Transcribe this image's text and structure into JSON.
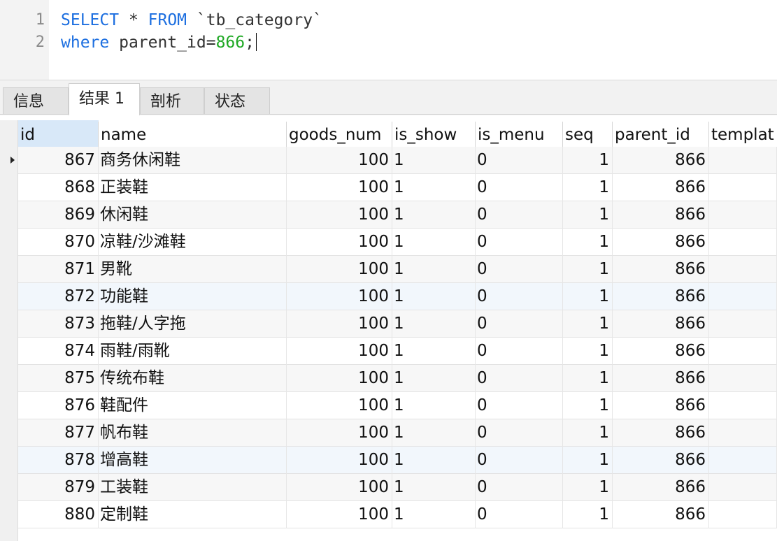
{
  "editor": {
    "line_numbers": [
      "1",
      "2"
    ],
    "line1": {
      "kw1": "SELECT",
      "t1": " * ",
      "kw2": "FROM",
      "t2": " `tb_category`"
    },
    "line2": {
      "kw1": "where",
      "t1": " parent_id=",
      "num": "866",
      "t2": ";"
    }
  },
  "tabs": [
    "信息",
    "结果 1",
    "剖析",
    "状态"
  ],
  "active_tab": 1,
  "columns": [
    "id",
    "name",
    "goods_num",
    "is_show",
    "is_menu",
    "seq",
    "parent_id",
    "templat"
  ],
  "rows": [
    [
      "867",
      "商务休闲鞋",
      "100",
      "1",
      "0",
      "1",
      "866",
      ""
    ],
    [
      "868",
      "正装鞋",
      "100",
      "1",
      "0",
      "1",
      "866",
      ""
    ],
    [
      "869",
      "休闲鞋",
      "100",
      "1",
      "0",
      "1",
      "866",
      ""
    ],
    [
      "870",
      "凉鞋/沙滩鞋",
      "100",
      "1",
      "0",
      "1",
      "866",
      ""
    ],
    [
      "871",
      "男靴",
      "100",
      "1",
      "0",
      "1",
      "866",
      ""
    ],
    [
      "872",
      "功能鞋",
      "100",
      "1",
      "0",
      "1",
      "866",
      ""
    ],
    [
      "873",
      "拖鞋/人字拖",
      "100",
      "1",
      "0",
      "1",
      "866",
      ""
    ],
    [
      "874",
      "雨鞋/雨靴",
      "100",
      "1",
      "0",
      "1",
      "866",
      ""
    ],
    [
      "875",
      "传统布鞋",
      "100",
      "1",
      "0",
      "1",
      "866",
      ""
    ],
    [
      "876",
      "鞋配件",
      "100",
      "1",
      "0",
      "1",
      "866",
      ""
    ],
    [
      "877",
      "帆布鞋",
      "100",
      "1",
      "0",
      "1",
      "866",
      ""
    ],
    [
      "878",
      "增高鞋",
      "100",
      "1",
      "0",
      "1",
      "866",
      ""
    ],
    [
      "879",
      "工装鞋",
      "100",
      "1",
      "0",
      "1",
      "866",
      ""
    ],
    [
      "880",
      "定制鞋",
      "100",
      "1",
      "0",
      "1",
      "866",
      ""
    ]
  ]
}
